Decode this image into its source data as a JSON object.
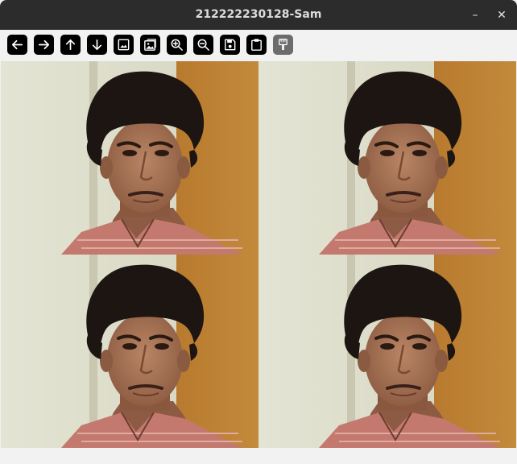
{
  "window": {
    "title": "212222230128-Sam",
    "minimize_glyph": "–",
    "close_glyph": "✕"
  },
  "toolbar": {
    "buttons": [
      {
        "icon": "arrow-left-icon"
      },
      {
        "icon": "arrow-right-icon"
      },
      {
        "icon": "arrow-up-icon"
      },
      {
        "icon": "arrow-down-icon"
      },
      {
        "icon": "image-icon"
      },
      {
        "icon": "image-gallery-icon"
      },
      {
        "icon": "zoom-in-icon"
      },
      {
        "icon": "zoom-out-icon"
      },
      {
        "icon": "save-icon"
      },
      {
        "icon": "clipboard-icon"
      },
      {
        "icon": "paint-brush-icon",
        "disabled": true
      }
    ]
  },
  "image_grid": {
    "rows": 2,
    "cols": 2,
    "tile_content": "photo-of-person"
  },
  "colors": {
    "titlebar": "#2c2c2c",
    "toolbar": "#f2f2f2",
    "button": "#000000",
    "button_disabled": "#6c6c6c"
  }
}
